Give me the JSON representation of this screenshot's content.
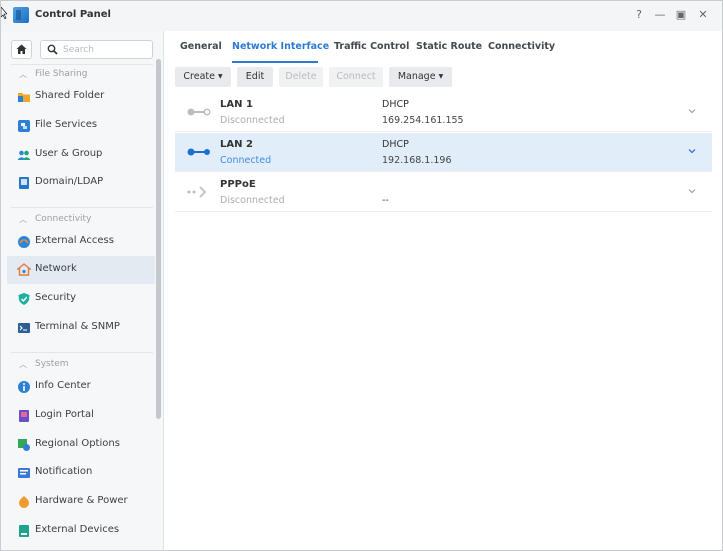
{
  "window": {
    "title": "Control Panel",
    "help": "?",
    "minimize": "—",
    "maximize": "▣",
    "close": "✕"
  },
  "sidebar": {
    "search_placeholder": "Search",
    "sections": [
      {
        "label": "File Sharing",
        "items": [
          {
            "label": "Shared Folder",
            "icon": "folder-icon",
            "color": "#f0a52c"
          },
          {
            "label": "File Services",
            "icon": "file-services-icon",
            "color": "#2f7fd8"
          },
          {
            "label": "User & Group",
            "icon": "users-icon",
            "color": "#1fa37a"
          },
          {
            "label": "Domain/LDAP",
            "icon": "domain-icon",
            "color": "#2a76c6"
          }
        ]
      },
      {
        "label": "Connectivity",
        "items": [
          {
            "label": "External Access",
            "icon": "external-access-icon",
            "color": "#2f86d8"
          },
          {
            "label": "Network",
            "icon": "network-icon",
            "color": "#e07b3a"
          },
          {
            "label": "Security",
            "icon": "security-icon",
            "color": "#1eb0a0"
          },
          {
            "label": "Terminal & SNMP",
            "icon": "terminal-icon",
            "color": "#2d5e94"
          }
        ]
      },
      {
        "label": "System",
        "items": [
          {
            "label": "Info Center",
            "icon": "info-icon",
            "color": "#2b7fd4"
          },
          {
            "label": "Login Portal",
            "icon": "login-portal-icon",
            "color": "#6b4fc6"
          },
          {
            "label": "Regional Options",
            "icon": "regional-icon",
            "color": "#37a55a"
          },
          {
            "label": "Notification",
            "icon": "notification-icon",
            "color": "#3b79d6"
          },
          {
            "label": "Hardware & Power",
            "icon": "hardware-icon",
            "color": "#ef9b2f"
          },
          {
            "label": "External Devices",
            "icon": "external-devices-icon",
            "color": "#1ea38e"
          }
        ]
      }
    ]
  },
  "tabs": [
    "General",
    "Network Interface",
    "Traffic Control",
    "Static Route",
    "Connectivity"
  ],
  "active_tab": "Network Interface",
  "toolbar": {
    "create": "Create",
    "edit": "Edit",
    "delete": "Delete",
    "connect": "Connect",
    "manage": "Manage"
  },
  "interfaces": [
    {
      "name": "LAN 1",
      "status": "Disconnected",
      "type": "DHCP",
      "address": "169.254.161.155"
    },
    {
      "name": "LAN 2",
      "status": "Connected",
      "type": "DHCP",
      "address": "192.168.1.196"
    },
    {
      "name": "PPPoE",
      "status": "Disconnected",
      "type": "",
      "address": "--"
    }
  ],
  "colors": {
    "accent": "#2b7bd6",
    "selected_row": "#e1edf9"
  }
}
